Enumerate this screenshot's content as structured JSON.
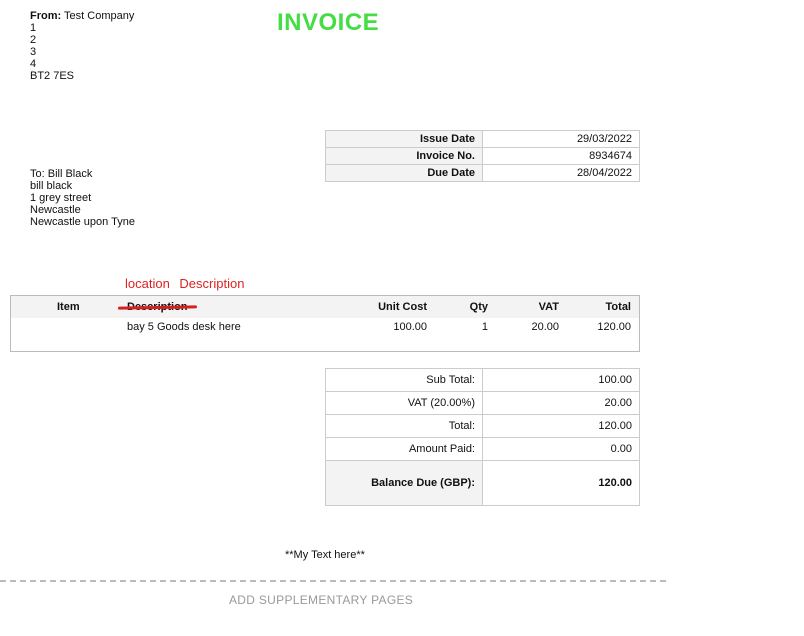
{
  "title": "INVOICE",
  "from": {
    "label": "From:",
    "company": "Test Company",
    "lines": [
      "1",
      "2",
      "3",
      "4",
      "BT2 7ES"
    ]
  },
  "info": [
    {
      "key": "Issue Date",
      "value": "29/03/2022"
    },
    {
      "key": "Invoice No.",
      "value": "8934674"
    },
    {
      "key": "Due Date",
      "value": "28/04/2022"
    }
  ],
  "to": {
    "label": "To:",
    "name": "Bill Black",
    "lines": [
      "bill black",
      "1 grey street",
      "Newcastle",
      "Newcastle upon Tyne"
    ]
  },
  "annotation": "location Description",
  "items": {
    "headers": {
      "item": "Item",
      "description": "Description",
      "unit_cost": "Unit Cost",
      "qty": "Qty",
      "vat": "VAT",
      "total": "Total"
    },
    "rows": [
      {
        "item": "",
        "description": "bay 5 Goods desk here",
        "unit_cost": "100.00",
        "qty": "1",
        "vat": "20.00",
        "total": "120.00"
      }
    ]
  },
  "totals": [
    {
      "key": "Sub Total:",
      "value": "100.00"
    },
    {
      "key": "VAT (20.00%)",
      "value": "20.00"
    },
    {
      "key": "Total:",
      "value": "120.00"
    },
    {
      "key": "Amount Paid:",
      "value": "0.00"
    },
    {
      "key": "Balance Due (GBP):",
      "value": "120.00"
    }
  ],
  "footer_text": "**My Text here**",
  "supplementary_label": "ADD SUPPLEMENTARY PAGES",
  "colors": {
    "title": "#44dd44",
    "annotation": "#dd2222",
    "strike": "#d62020"
  }
}
